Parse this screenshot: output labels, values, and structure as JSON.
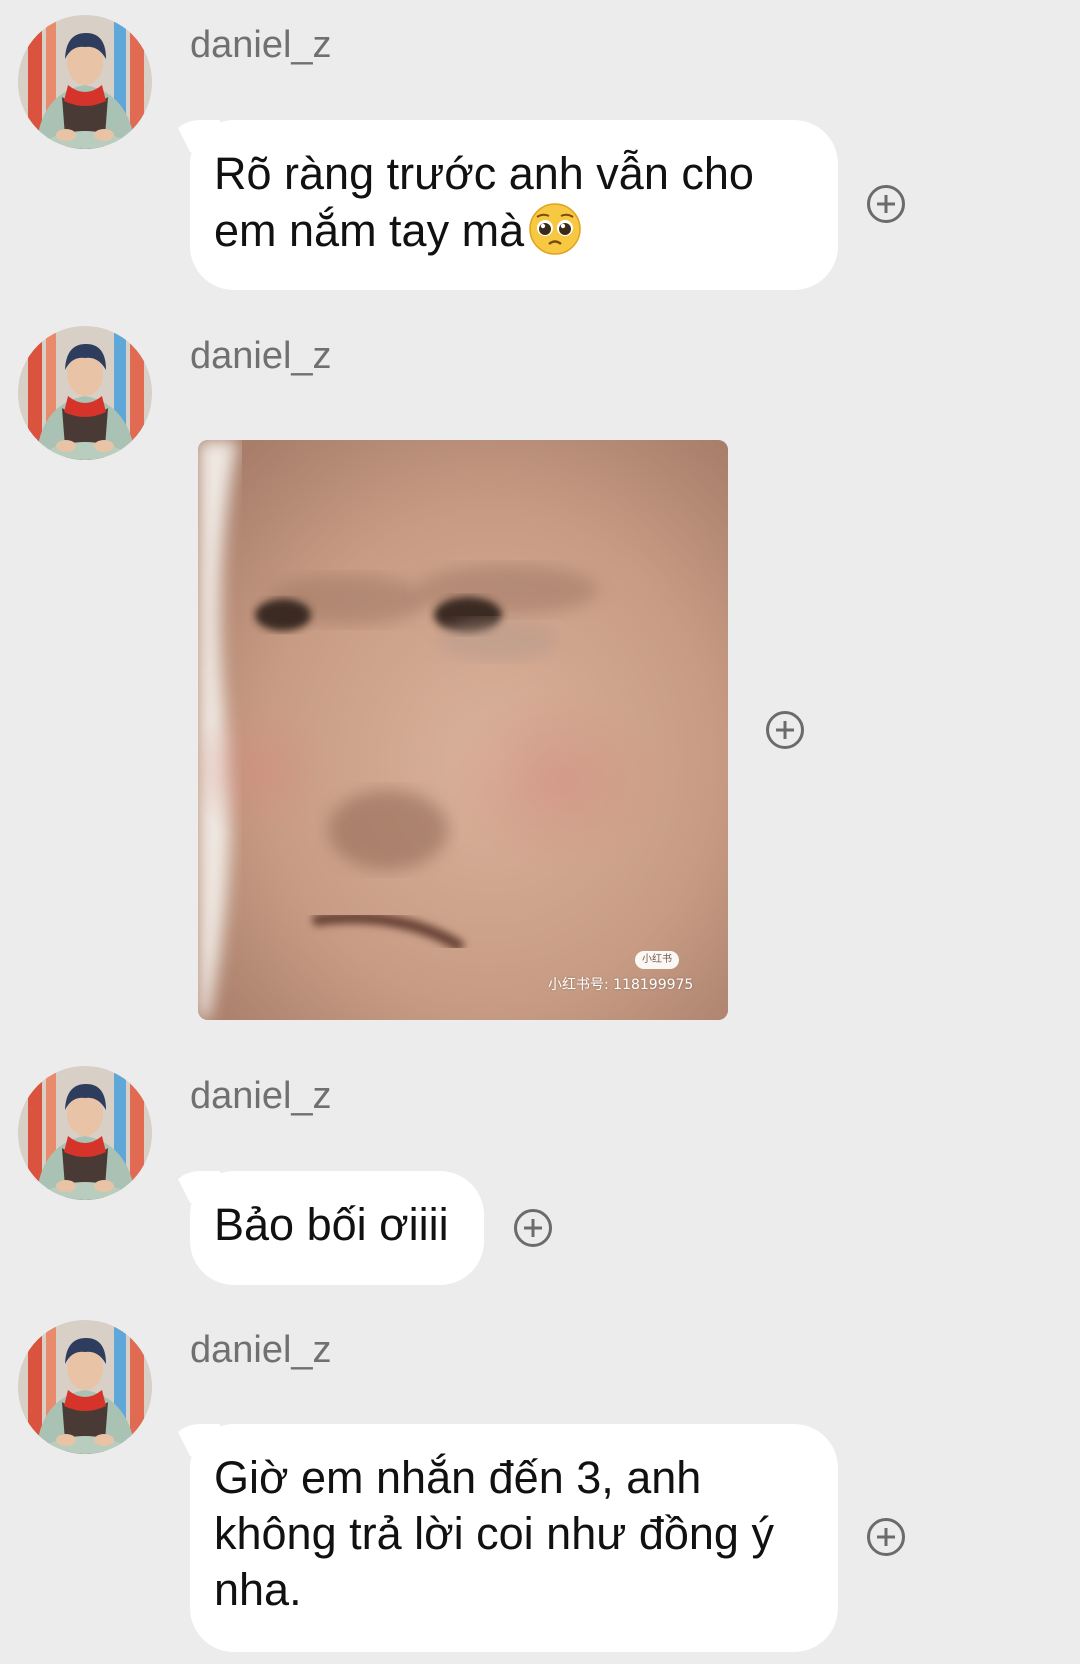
{
  "messages": [
    {
      "sender": "daniel_z",
      "text_line1": "Rõ ràng trước anh vẫn cho",
      "text_line2": "em nắm tay mà"
    },
    {
      "sender": "daniel_z",
      "image_watermark_badge": "小红书",
      "image_watermark_text": "小红书号: 118199975"
    },
    {
      "sender": "daniel_z",
      "text": "Bảo bối ơiiii"
    },
    {
      "sender": "daniel_z",
      "text_line1": "Giờ em nhắn đến 3, anh",
      "text_line2": "không trả lời coi như đồng ý",
      "text_line3": "nha."
    }
  ],
  "icons": {
    "avatar": "avatar-photo",
    "pleading": "pleading-face-emoji",
    "add_reaction": "plus-circle-icon"
  },
  "colors": {
    "background": "#ececec",
    "bubble": "#ffffff",
    "username": "#707070",
    "text": "#111111"
  }
}
